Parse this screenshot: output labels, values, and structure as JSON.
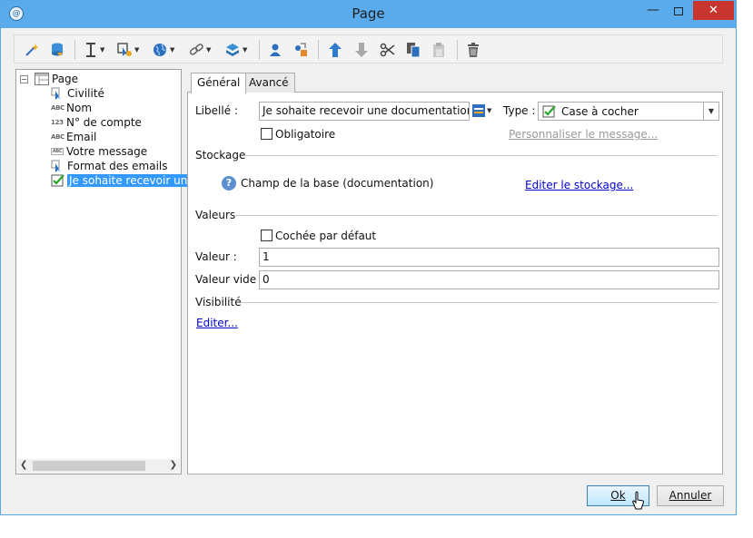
{
  "window": {
    "title": "Page"
  },
  "toolbar": {
    "icons": [
      "wand-icon",
      "database-icon",
      "text-cursor-icon",
      "cursor-settings-icon",
      "globe-icon",
      "link-icon",
      "layers-icon",
      "user-icon",
      "shapes-icon",
      "arrow-up-icon",
      "arrow-down-icon",
      "cut-icon",
      "copy-icon",
      "paste-icon",
      "delete-icon"
    ]
  },
  "tree": {
    "root": "Page",
    "items": [
      {
        "type": "",
        "label": "Civilité"
      },
      {
        "type": "ABC",
        "label": "Nom"
      },
      {
        "type": "123",
        "label": "N° de compte"
      },
      {
        "type": "ABC",
        "label": "Email"
      },
      {
        "type": "ABC",
        "label": "Votre message"
      },
      {
        "type": "",
        "label": "Format des emails"
      },
      {
        "type": "",
        "label": "Je sohaite recevoir une..."
      }
    ]
  },
  "tabs": [
    "Général",
    "Avancé"
  ],
  "form": {
    "libelle_label": "Libellé :",
    "libelle_value": "Je sohaite recevoir une documentation",
    "type_label": "Type :",
    "type_value": "Case à cocher",
    "obligatoire_label": "Obligatoire",
    "personnaliser_link": "Personnaliser le message...",
    "stockage_header": "Stockage",
    "champ_text": "Champ de la base (documentation)",
    "editer_stockage_link": "Editer le stockage...",
    "valeurs_header": "Valeurs",
    "cochee_label": "Cochée par défaut",
    "valeur_label": "Valeur :",
    "valeur_value": "1",
    "valeur_vide_label": "Valeur vide :",
    "valeur_vide_value": "0",
    "visibilite_header": "Visibilité",
    "editer_link": "Editer..."
  },
  "buttons": {
    "ok": "Ok",
    "annuler": "Annuler"
  }
}
